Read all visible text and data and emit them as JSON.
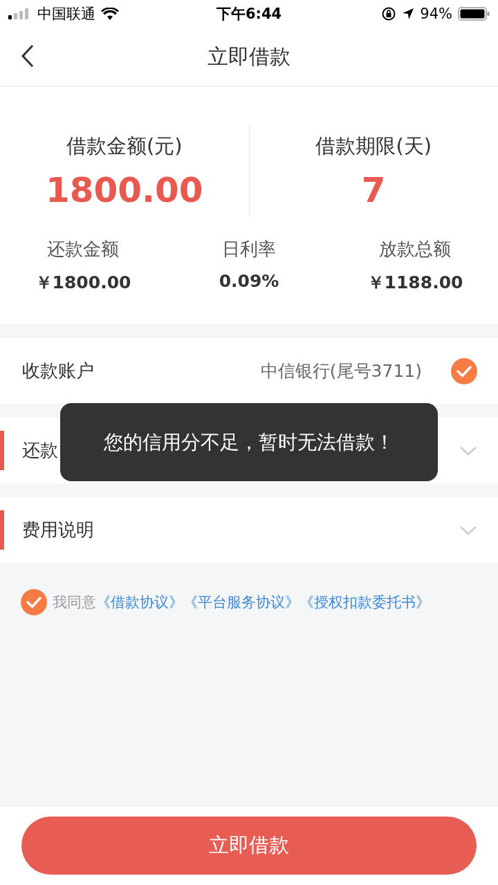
{
  "status_bar": {
    "carrier": "中国联通",
    "time": "下午6:44",
    "battery": "94%"
  },
  "nav": {
    "title": "立即借款"
  },
  "summary": {
    "amount_label": "借款金额(元)",
    "amount": "1800.00",
    "term_label": "借款期限(天)",
    "term": "7",
    "stats": [
      {
        "label": "还款金额",
        "value": "￥1800.00"
      },
      {
        "label": "日利率",
        "value": "0.09%"
      },
      {
        "label": "放款总额",
        "value": "￥1188.00"
      }
    ]
  },
  "account": {
    "label": "收款账户",
    "value": "中信银行(尾号3711)",
    "checked": true
  },
  "sections": [
    {
      "label": "还款",
      "expanded": false
    },
    {
      "label": "费用说明",
      "expanded": false
    }
  ],
  "agreement": {
    "checked": true,
    "prefix": "我同意",
    "links": [
      "《借款协议》",
      "《平台服务协议》",
      "《授权扣款委托书》"
    ]
  },
  "toast": "您的信用分不足，暂时无法借款！",
  "submit": "立即借款"
}
